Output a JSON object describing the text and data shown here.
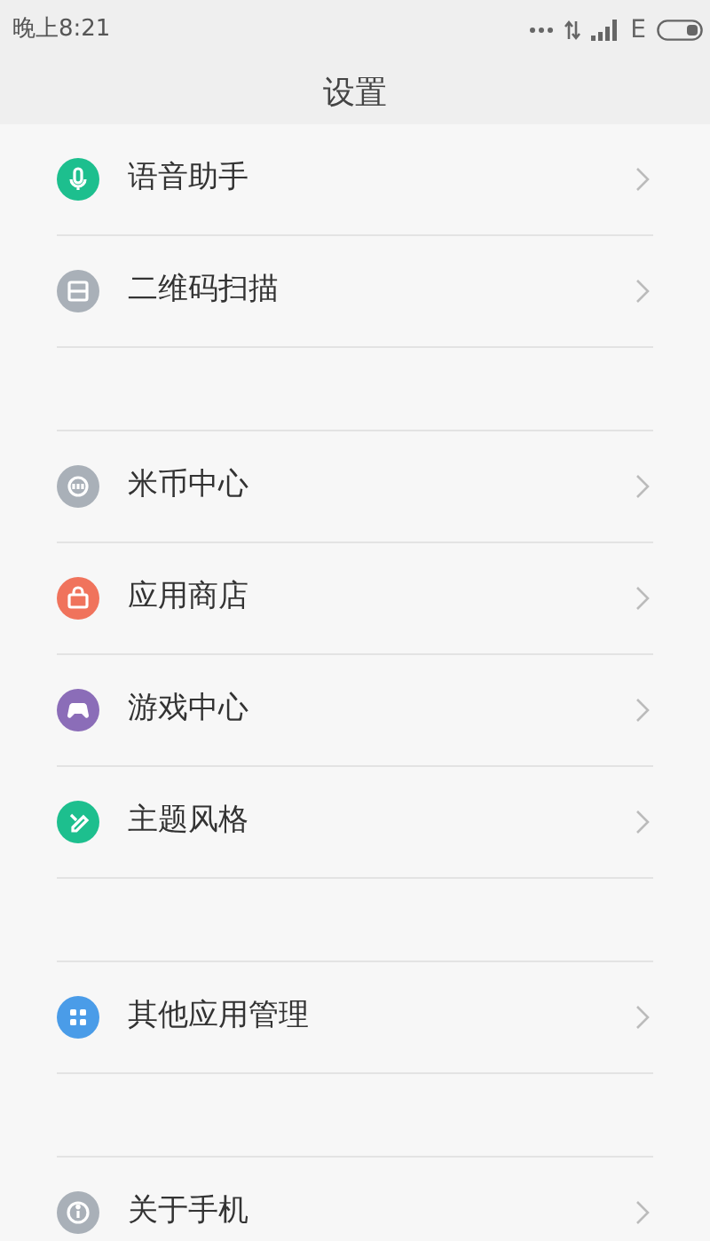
{
  "status_bar": {
    "time": "晚上8:21",
    "network": "E"
  },
  "title": "设置",
  "sections": [
    {
      "items": [
        {
          "label": "语音助手",
          "color": "#1dbf8e"
        },
        {
          "label": "二维码扫描",
          "color": "#a9b0b8"
        }
      ]
    },
    {
      "items": [
        {
          "label": "米币中心",
          "color": "#a9b0b8"
        },
        {
          "label": "应用商店",
          "color": "#f0735c"
        },
        {
          "label": "游戏中心",
          "color": "#8b6db8"
        },
        {
          "label": "主题风格",
          "color": "#1dbf8e"
        }
      ]
    },
    {
      "items": [
        {
          "label": "其他应用管理",
          "color": "#4a9ce8"
        }
      ]
    },
    {
      "items": [
        {
          "label": "关于手机",
          "color": "#a9b0b8"
        }
      ]
    }
  ]
}
